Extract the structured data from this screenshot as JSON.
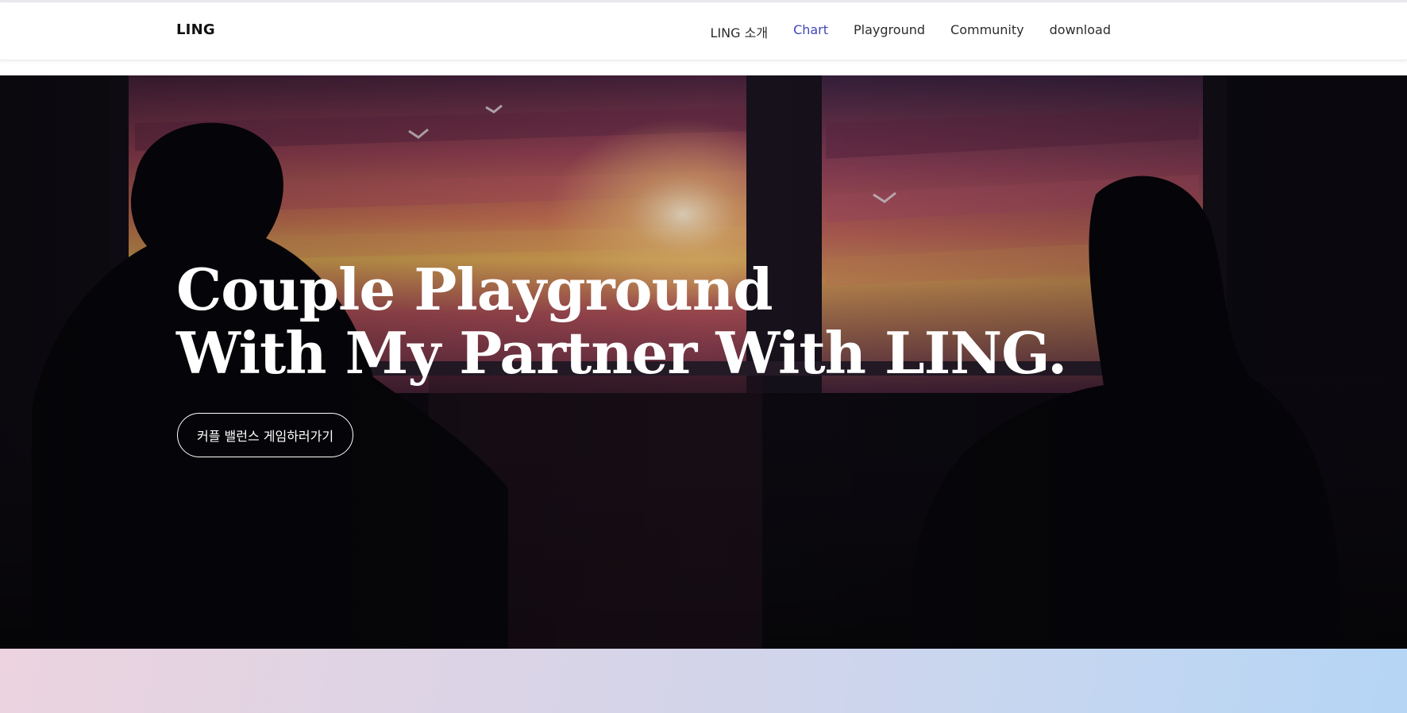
{
  "nav": {
    "brand": "LING",
    "items": [
      {
        "label": "LING 소개",
        "active": false
      },
      {
        "label": "Chart",
        "active": true
      },
      {
        "label": "Playground",
        "active": false
      },
      {
        "label": "Community",
        "active": false
      },
      {
        "label": "download",
        "active": false
      }
    ]
  },
  "hero": {
    "title_line1": "Couple Playground",
    "title_line2": "With My Partner With LING.",
    "cta_label": "커플 밸런스 게임하러가기"
  },
  "colors": {
    "nav_active": "#4146b7",
    "nav_text": "#2c2c2c",
    "hero_text": "#ffffff",
    "band_gradient_start": "#ecd3df",
    "band_gradient_end": "#b5d5f5"
  }
}
